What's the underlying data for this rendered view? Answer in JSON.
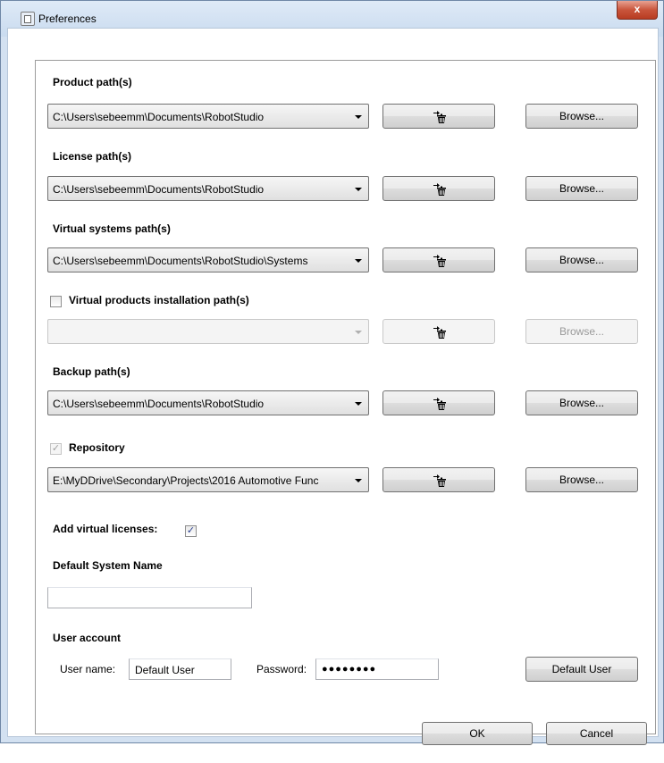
{
  "window": {
    "title": "Preferences",
    "close_glyph": "x"
  },
  "paths": {
    "product": {
      "label": "Product path(s)",
      "value": "C:\\Users\\sebeemm\\Documents\\RobotStudio",
      "browse": "Browse..."
    },
    "license": {
      "label": "License path(s)",
      "value": "C:\\Users\\sebeemm\\Documents\\RobotStudio",
      "browse": "Browse..."
    },
    "virtual_systems": {
      "label": "Virtual systems path(s)",
      "value": "C:\\Users\\sebeemm\\Documents\\RobotStudio\\Systems",
      "browse": "Browse..."
    },
    "virtual_products": {
      "label": "Virtual products installation path(s)",
      "checked": false,
      "value": "",
      "browse": "Browse..."
    },
    "backup": {
      "label": "Backup path(s)",
      "value": "C:\\Users\\sebeemm\\Documents\\RobotStudio",
      "browse": "Browse..."
    },
    "repository": {
      "label": "Repository",
      "checked": true,
      "check_glyph": "✓",
      "value": "E:\\MyDDrive\\Secondary\\Projects\\2016 Automotive Func",
      "browse": "Browse..."
    }
  },
  "virtual_licenses": {
    "label": "Add virtual licenses:",
    "checked": true,
    "check_glyph": "✓"
  },
  "default_system": {
    "label": "Default System Name",
    "value": ""
  },
  "user_account": {
    "label": "User account",
    "username_label": "User name:",
    "username_value": "Default User",
    "password_label": "Password:",
    "password_value": "●●●●●●●●",
    "default_user_button": "Default User"
  },
  "footer": {
    "ok": "OK",
    "cancel": "Cancel"
  },
  "icons": {
    "remove": "trash-icon",
    "app": "app-icon",
    "combo_arrow": "chevron-down-icon"
  },
  "colors": {
    "title_bar": "#d3e1f1",
    "close_button": "#c9553c",
    "checkbox_mark": "#2a3f8f"
  }
}
